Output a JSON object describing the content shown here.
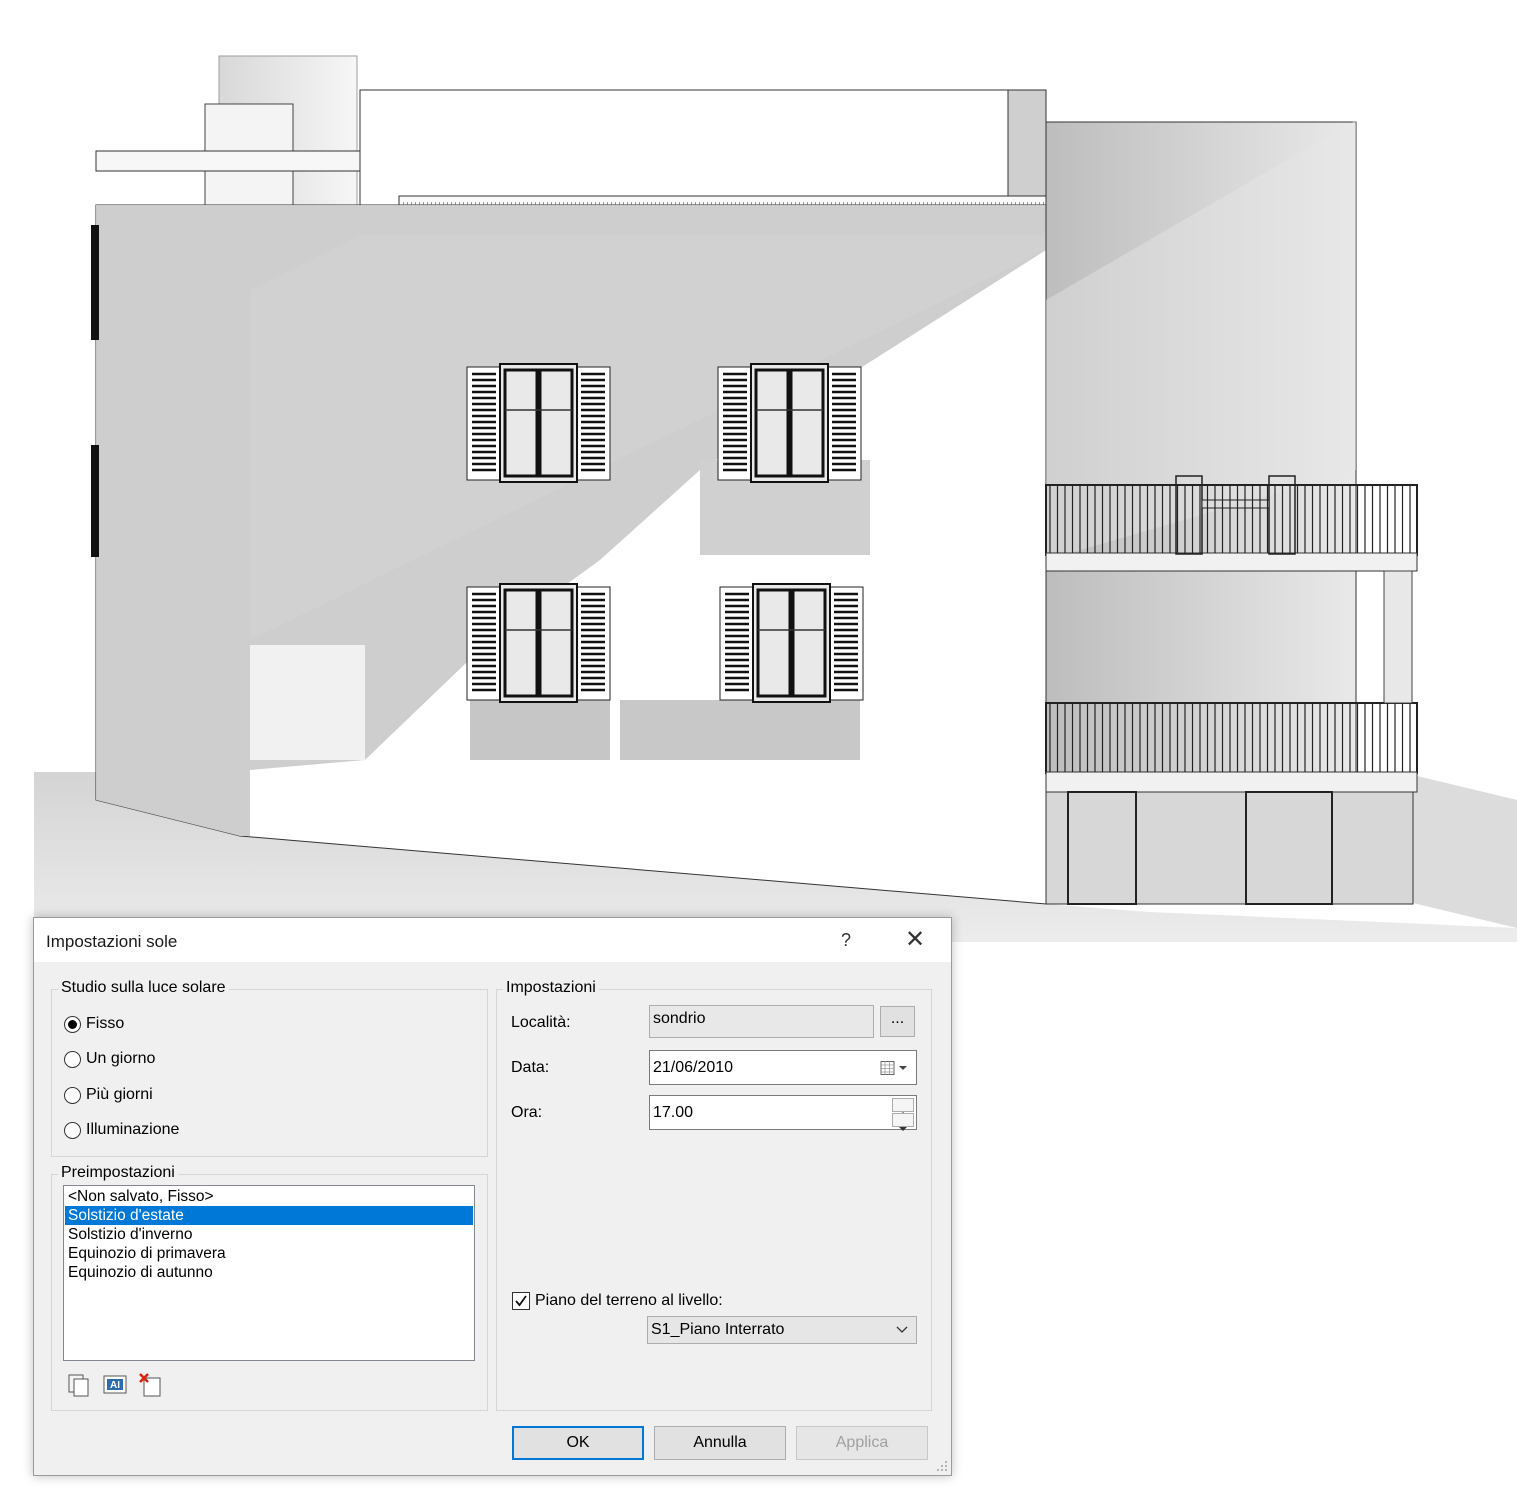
{
  "dialog": {
    "title": "Impostazioni sole",
    "help_label": "?",
    "close_label": "✕"
  },
  "sun_study": {
    "group_label": "Studio sulla luce solare",
    "options": [
      {
        "label": "Fisso",
        "selected": true
      },
      {
        "label": "Un giorno",
        "selected": false
      },
      {
        "label": "Più giorni",
        "selected": false
      },
      {
        "label": "Illuminazione",
        "selected": false
      }
    ]
  },
  "presets": {
    "group_label": "Preimpostazioni",
    "items": [
      {
        "label": "<Non salvato, Fisso>",
        "selected": false
      },
      {
        "label": "Solstizio d'estate",
        "selected": true
      },
      {
        "label": "Solstizio d'inverno",
        "selected": false
      },
      {
        "label": "Equinozio di primavera",
        "selected": false
      },
      {
        "label": "Equinozio di autunno",
        "selected": false
      }
    ],
    "icons": [
      "duplicate-icon",
      "rename-icon",
      "delete-icon"
    ]
  },
  "settings": {
    "group_label": "Impostazioni",
    "location_label": "Località:",
    "location_value": "sondrio",
    "browse_label": "...",
    "date_label": "Data:",
    "date_value": "21/06/2010",
    "time_label": "Ora:",
    "time_value": "17.00",
    "ground_plane_label": "Piano del terreno al livello:",
    "ground_plane_checked": true,
    "level_value": "S1_Piano Interrato"
  },
  "buttons": {
    "ok": "OK",
    "cancel": "Annulla",
    "apply": "Applica"
  },
  "colors": {
    "selection": "#0078d7",
    "dialog_bg": "#f0f0f0",
    "default_button_border": "#0078d7",
    "wall_shadow": "#c8c8c8"
  }
}
